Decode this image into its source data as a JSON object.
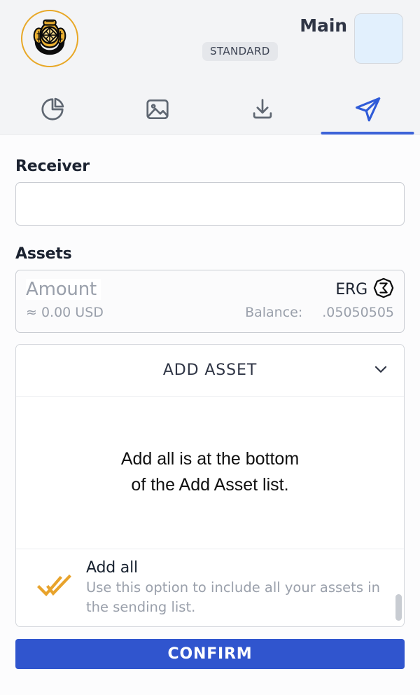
{
  "header": {
    "logo_icon": "diving-helmet-logo",
    "badge": "STANDARD",
    "wallet_name": "Main",
    "avatar_color": "#e2f0fd"
  },
  "tabs": [
    {
      "icon": "pie-chart-icon",
      "name": "assets",
      "active": false
    },
    {
      "icon": "image-icon",
      "name": "nfts",
      "active": false
    },
    {
      "icon": "download-icon",
      "name": "receive",
      "active": false
    },
    {
      "icon": "send-plane-icon",
      "name": "send",
      "active": true
    }
  ],
  "form": {
    "receiver_label": "Receiver",
    "receiver_value": "",
    "receiver_placeholder": "",
    "assets_label": "Assets"
  },
  "amount": {
    "placeholder": "Amount",
    "value": "",
    "fiat": "≈ 0.00 USD",
    "balance_label": "Balance:",
    "balance_value": ".05050505",
    "token_symbol": "ERG",
    "token_icon": "erg-sigma-icon"
  },
  "asset_panel": {
    "header_label": "ADD ASSET",
    "chevron_icon": "chevron-down-icon",
    "message": "Add all is at the bottom\nof the Add Asset list.",
    "message_line1": "Add all is at the bottom",
    "message_line2": "of the Add Asset list.",
    "add_all": {
      "icon": "double-check-icon",
      "icon_color": "#e8a32c",
      "title": "Add all",
      "description": "Use this option to include all your assets in the sending list."
    }
  },
  "footer": {
    "confirm_label": "CONFIRM",
    "confirm_color": "#3055ce"
  }
}
